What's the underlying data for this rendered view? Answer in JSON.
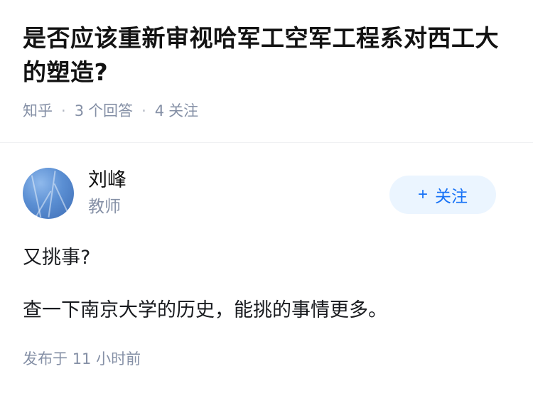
{
  "question": {
    "title": "是否应该重新审视哈军工空军工程系对西工大的塑造?",
    "source": "知乎",
    "answer_count": "3",
    "answer_label": "个回答",
    "follower_count": "4",
    "follower_label": "关注"
  },
  "answer": {
    "author": {
      "name": "刘峰",
      "headline": "教师",
      "avatar": "avatar-blue-sky-branches"
    },
    "follow_button": {
      "icon": "plus-icon",
      "icon_glyph": "+",
      "label": "关注"
    },
    "paragraphs": [
      "又挑事?",
      "查一下南京大学的历史，能挑的事情更多。"
    ],
    "published_label": "发布于",
    "published_time": "11 小时前"
  },
  "colors": {
    "accent": "#1772f6",
    "follow_bg": "#ebf5ff",
    "meta_gray": "#8590a6",
    "text": "#191b1f"
  }
}
